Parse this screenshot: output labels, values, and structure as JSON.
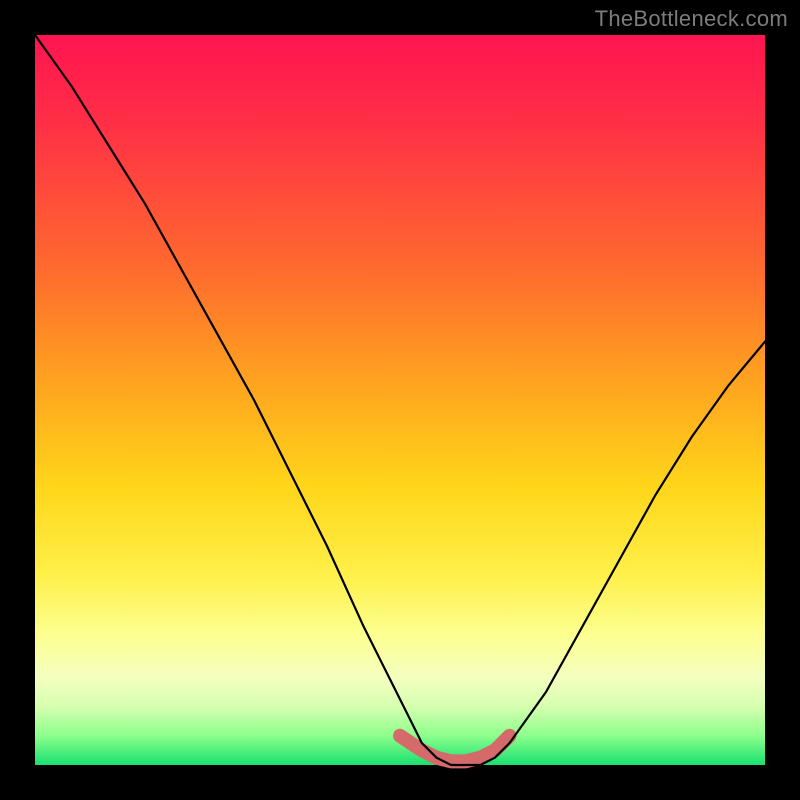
{
  "watermark": "TheBottleneck.com",
  "chart_data": {
    "type": "line",
    "title": "",
    "xlabel": "",
    "ylabel": "",
    "xlim": [
      0,
      100
    ],
    "ylim": [
      0,
      100
    ],
    "series": [
      {
        "name": "bottleneck-curve",
        "x": [
          0,
          5,
          10,
          15,
          20,
          25,
          30,
          35,
          40,
          45,
          50,
          53,
          55,
          57,
          59,
          61,
          63,
          65,
          70,
          75,
          80,
          85,
          90,
          95,
          100
        ],
        "values": [
          100,
          93,
          85,
          77,
          68,
          59,
          50,
          40,
          30,
          19,
          9,
          3,
          1,
          0,
          0,
          0,
          1,
          3,
          10,
          19,
          28,
          37,
          45,
          52,
          58
        ]
      },
      {
        "name": "highlight-band",
        "x": [
          50,
          53,
          55,
          57,
          59,
          61,
          63,
          65
        ],
        "values": [
          4,
          2,
          1,
          0.5,
          0.5,
          1,
          2,
          4
        ]
      }
    ],
    "colors": {
      "curve": "#000000",
      "highlight": "#d46a6a",
      "gradient_top": "#ff1450",
      "gradient_bottom": "#18e070"
    }
  }
}
